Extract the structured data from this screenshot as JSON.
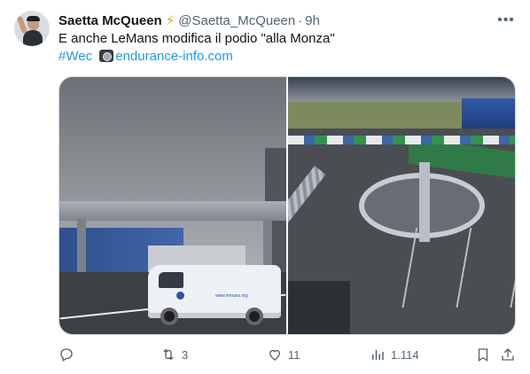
{
  "tweet": {
    "author": {
      "display_name": "Saetta McQueen",
      "badge_icon": "lightning-bolt-icon",
      "handle": "@Saetta_McQueen",
      "separator": "·",
      "time": "9h"
    },
    "text_line1": "E anche LeMans modifica il podio \"alla Monza\"",
    "hashtag": "#Wec",
    "camera_icon": "camera-icon",
    "link": "endurance-info.com",
    "van_text": "www.lemans.org",
    "stats": {
      "reposts": "3",
      "likes": "11",
      "views": "1.114"
    }
  },
  "colors": {
    "accent": "#1d9bf0",
    "text": "#0f1419",
    "muted": "#536471",
    "bolt": "#f4a300"
  }
}
